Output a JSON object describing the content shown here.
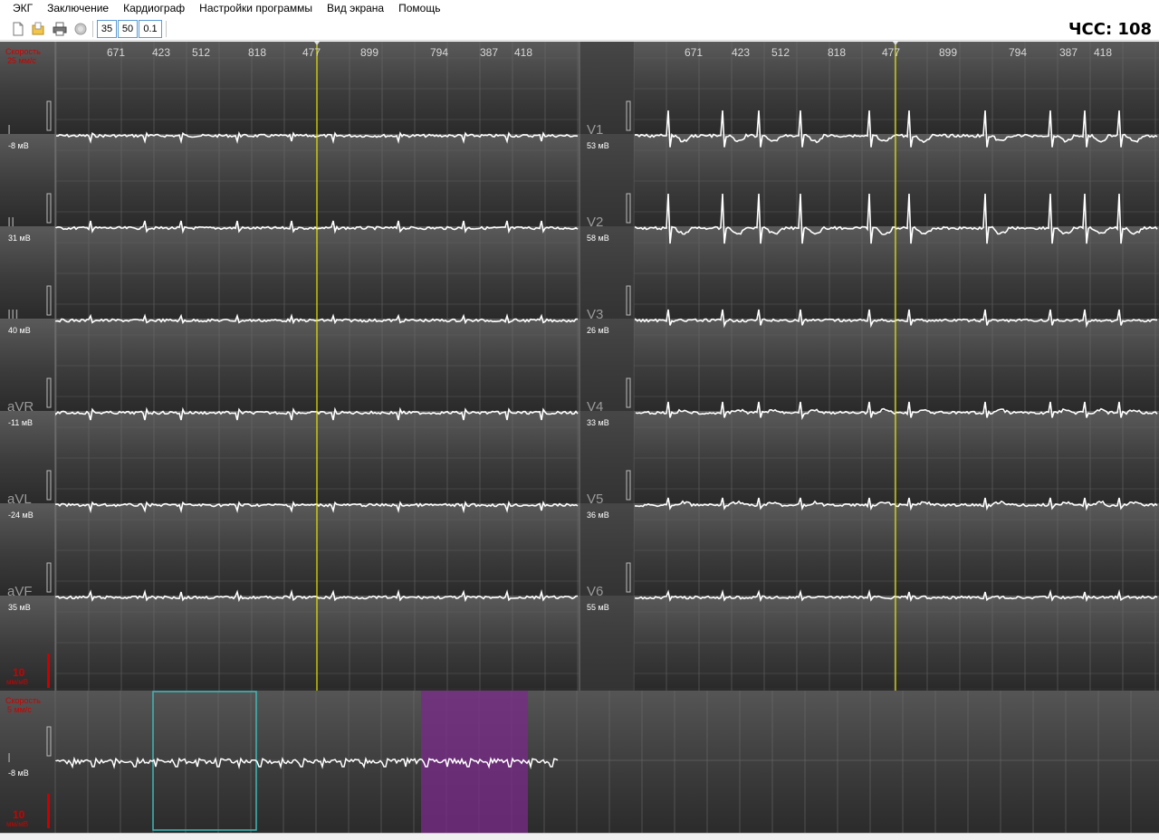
{
  "menu": [
    "ЭКГ",
    "Заключение",
    "Кардиограф",
    "Настройки программы",
    "Вид экрана",
    "Помощь"
  ],
  "toolbar": {
    "icons": [
      "new-document-icon",
      "open-folder-icon",
      "print-icon",
      "record-icon"
    ],
    "boxes": [
      "35",
      "50",
      "0.1"
    ]
  },
  "hr": "ЧСС: 108",
  "main": {
    "speed_label": "Скорость",
    "speed_value": "25 мм/с",
    "rr_intervals_left": [
      "671",
      "423",
      "512",
      "818",
      "477",
      "899",
      "794",
      "387",
      "418"
    ],
    "rr_intervals_right": [
      "671",
      "423",
      "512",
      "818",
      "477",
      "899",
      "794",
      "387",
      "418"
    ],
    "leads_left": [
      {
        "name": "I",
        "amp": "-8 мВ"
      },
      {
        "name": "II",
        "amp": "31 мВ"
      },
      {
        "name": "III",
        "amp": "40 мВ"
      },
      {
        "name": "aVR",
        "amp": "-11 мВ"
      },
      {
        "name": "aVL",
        "amp": "-24 мВ"
      },
      {
        "name": "aVF",
        "amp": "35 мВ"
      }
    ],
    "leads_right": [
      {
        "name": "V1",
        "amp": "53 мВ"
      },
      {
        "name": "V2",
        "amp": "58 мВ"
      },
      {
        "name": "V3",
        "amp": "26 мВ"
      },
      {
        "name": "V4",
        "amp": "33 мВ"
      },
      {
        "name": "V5",
        "amp": "36 мВ"
      },
      {
        "name": "V6",
        "amp": "55 мВ"
      }
    ],
    "gain_value": "10",
    "gain_unit": "мм/мВ"
  },
  "strip": {
    "speed_label": "Скорость",
    "speed_value": "5 мм/с",
    "lead": {
      "name": "I",
      "amp": "-8 мВ"
    },
    "gain_value": "10",
    "gain_unit": "мм/мВ"
  },
  "colors": {
    "cursor": "#e6e600",
    "label_red": "#cc0000",
    "trace": "#ffffff",
    "selection_cyan": "#3fb8b8",
    "selection_purple": "#7a2a8a"
  }
}
